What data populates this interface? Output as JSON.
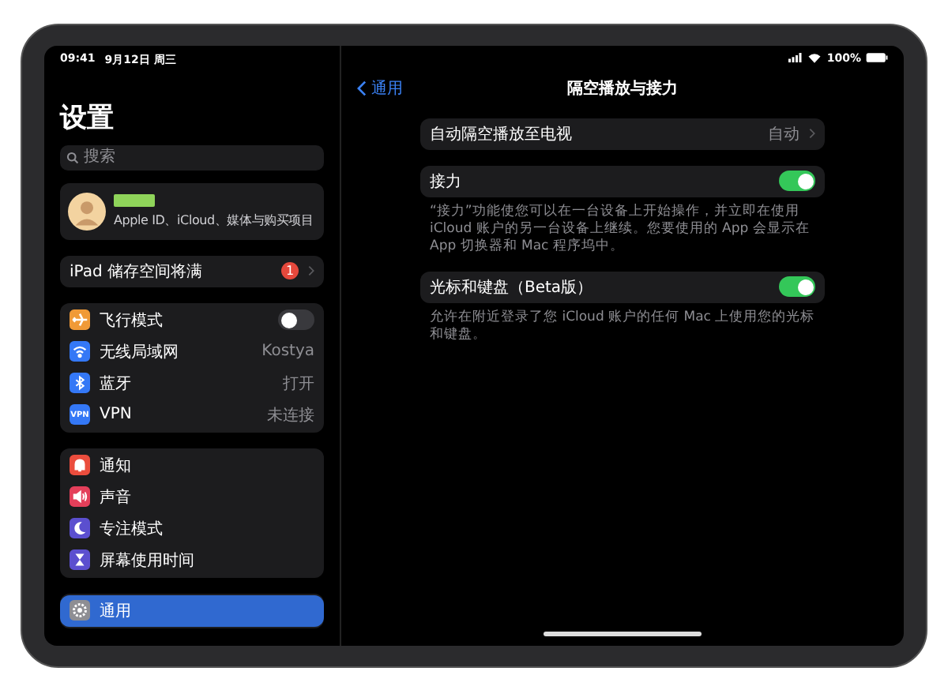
{
  "status_bar": {
    "time": "09:41",
    "date": "9月12日 周三",
    "battery": "100%"
  },
  "sidebar": {
    "title": "设置",
    "search": {
      "placeholder": "搜索"
    },
    "profile": {
      "subtitle": "Apple ID、iCloud、媒体与购买项目"
    },
    "alert": {
      "label": "iPad 储存空间将满",
      "badge": "1"
    },
    "groups": [
      [
        {
          "label": "飞行模式",
          "kind": "toggle",
          "on": false,
          "color": "#f09a37",
          "selected": false
        },
        {
          "label": "无线局域网",
          "kind": "value",
          "value": "Kostya",
          "color": "#3478f6",
          "selected": false
        },
        {
          "label": "蓝牙",
          "kind": "value",
          "value": "打开",
          "color": "#3478f6",
          "selected": false
        },
        {
          "label": "VPN",
          "kind": "value",
          "value": "未连接",
          "color": "#3478f6",
          "icon_text": "VPN",
          "selected": false
        }
      ],
      [
        {
          "label": "通知",
          "kind": "plain",
          "color": "#eb4d3d",
          "selected": false
        },
        {
          "label": "声音",
          "kind": "plain",
          "color": "#e43f5a",
          "selected": false
        },
        {
          "label": "专注模式",
          "kind": "plain",
          "color": "#5b4fcf",
          "selected": false
        },
        {
          "label": "屏幕使用时间",
          "kind": "plain",
          "color": "#5b4fcf",
          "selected": false
        }
      ],
      [
        {
          "label": "通用",
          "kind": "plain",
          "color": "#8e8e93",
          "selected": true
        }
      ]
    ]
  },
  "detail": {
    "back": "通用",
    "title": "隔空播放与接力",
    "groups": [
      {
        "label": "自动隔空播放至电视",
        "kind": "link",
        "value": "自动"
      },
      {
        "label": "接力",
        "kind": "toggle",
        "on": true,
        "footer": "“接力”功能使您可以在一台设备上开始操作，并立即在使用 iCloud 账户的另一台设备上继续。您要使用的 App 会显示在 App 切换器和 Mac 程序坞中。"
      },
      {
        "label": "光标和键盘（Beta版）",
        "kind": "toggle",
        "on": true,
        "footer": "允许在附近登录了您 iCloud 账户的任何 Mac 上使用您的光标和键盘。"
      }
    ]
  }
}
